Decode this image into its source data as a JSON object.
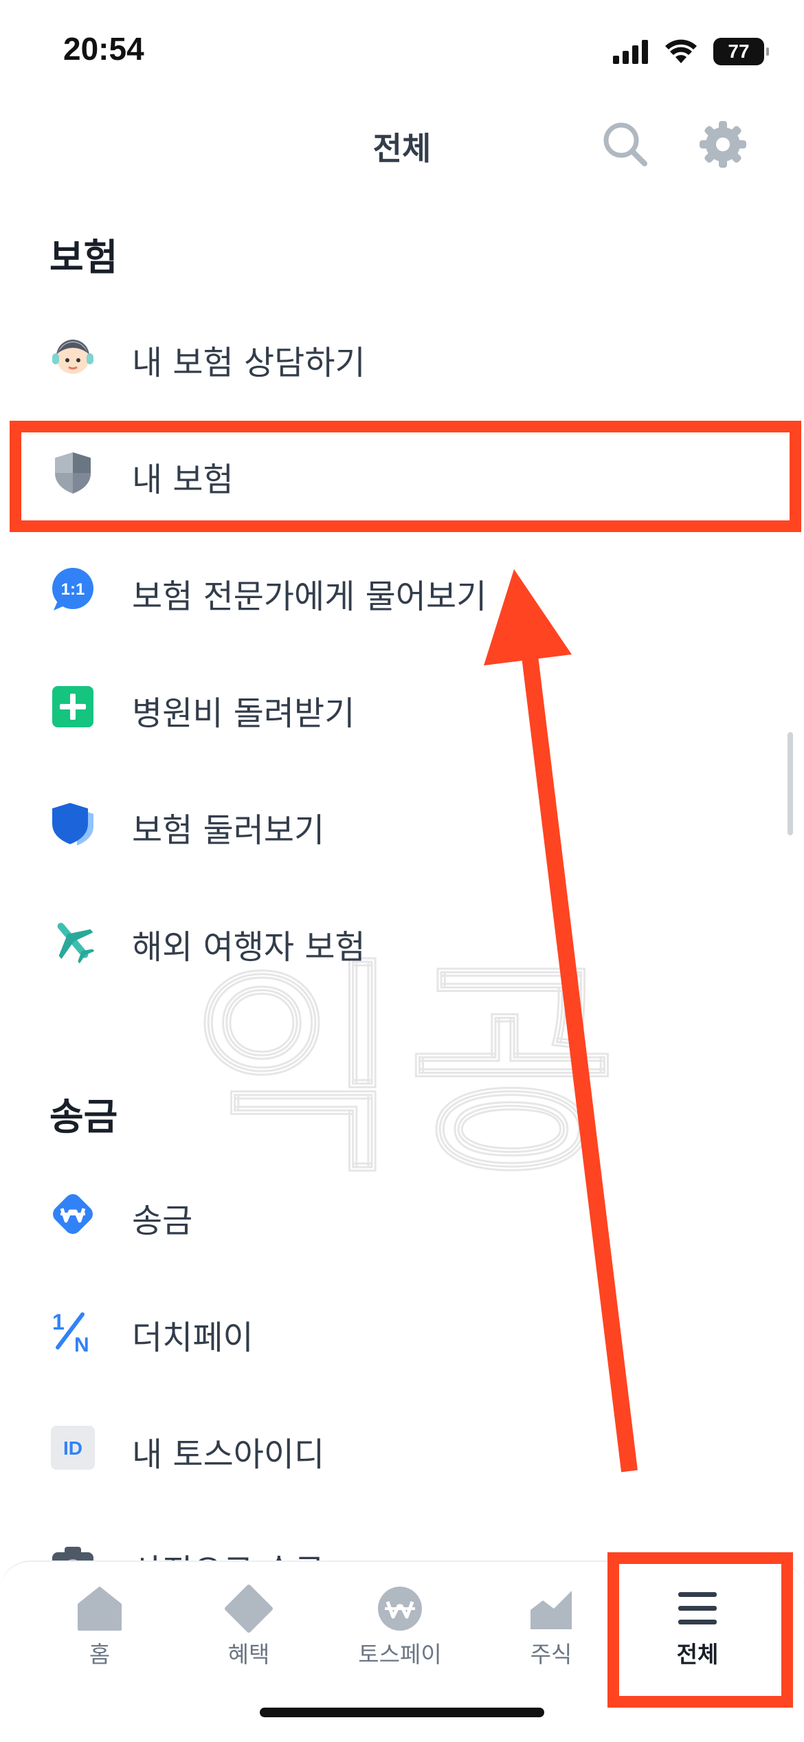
{
  "status": {
    "time": "20:54",
    "battery": "77"
  },
  "nav": {
    "title": "전체"
  },
  "sections": [
    {
      "title": "보험",
      "items": [
        {
          "label": "내 보험 상담하기",
          "icon": "counselor-icon"
        },
        {
          "label": "내 보험",
          "icon": "shield-icon"
        },
        {
          "label": "보험 전문가에게 물어보기",
          "icon": "chat-1on1-icon"
        },
        {
          "label": "병원비 돌려받기",
          "icon": "plus-icon"
        },
        {
          "label": "보험 둘러보기",
          "icon": "blue-shield-icon"
        },
        {
          "label": "해외 여행자 보험",
          "icon": "airplane-icon"
        }
      ]
    },
    {
      "title": "송금",
      "items": [
        {
          "label": "송금",
          "icon": "won-icon"
        },
        {
          "label": "더치페이",
          "icon": "one-n-icon"
        },
        {
          "label": "내 토스아이디",
          "icon": "id-icon"
        },
        {
          "label": "사진으로 송금",
          "icon": "camera-icon"
        }
      ]
    }
  ],
  "watermark": "익공",
  "tabs": [
    {
      "label": "홈",
      "icon": "home-icon"
    },
    {
      "label": "혜택",
      "icon": "diamond-icon"
    },
    {
      "label": "토스페이",
      "icon": "pay-icon"
    },
    {
      "label": "주식",
      "icon": "chart-icon"
    },
    {
      "label": "전체",
      "icon": "menu-icon",
      "active": true
    }
  ],
  "colors": {
    "highlight": "#ff4422",
    "accent": "#3182f6",
    "text": "#333d4b"
  }
}
